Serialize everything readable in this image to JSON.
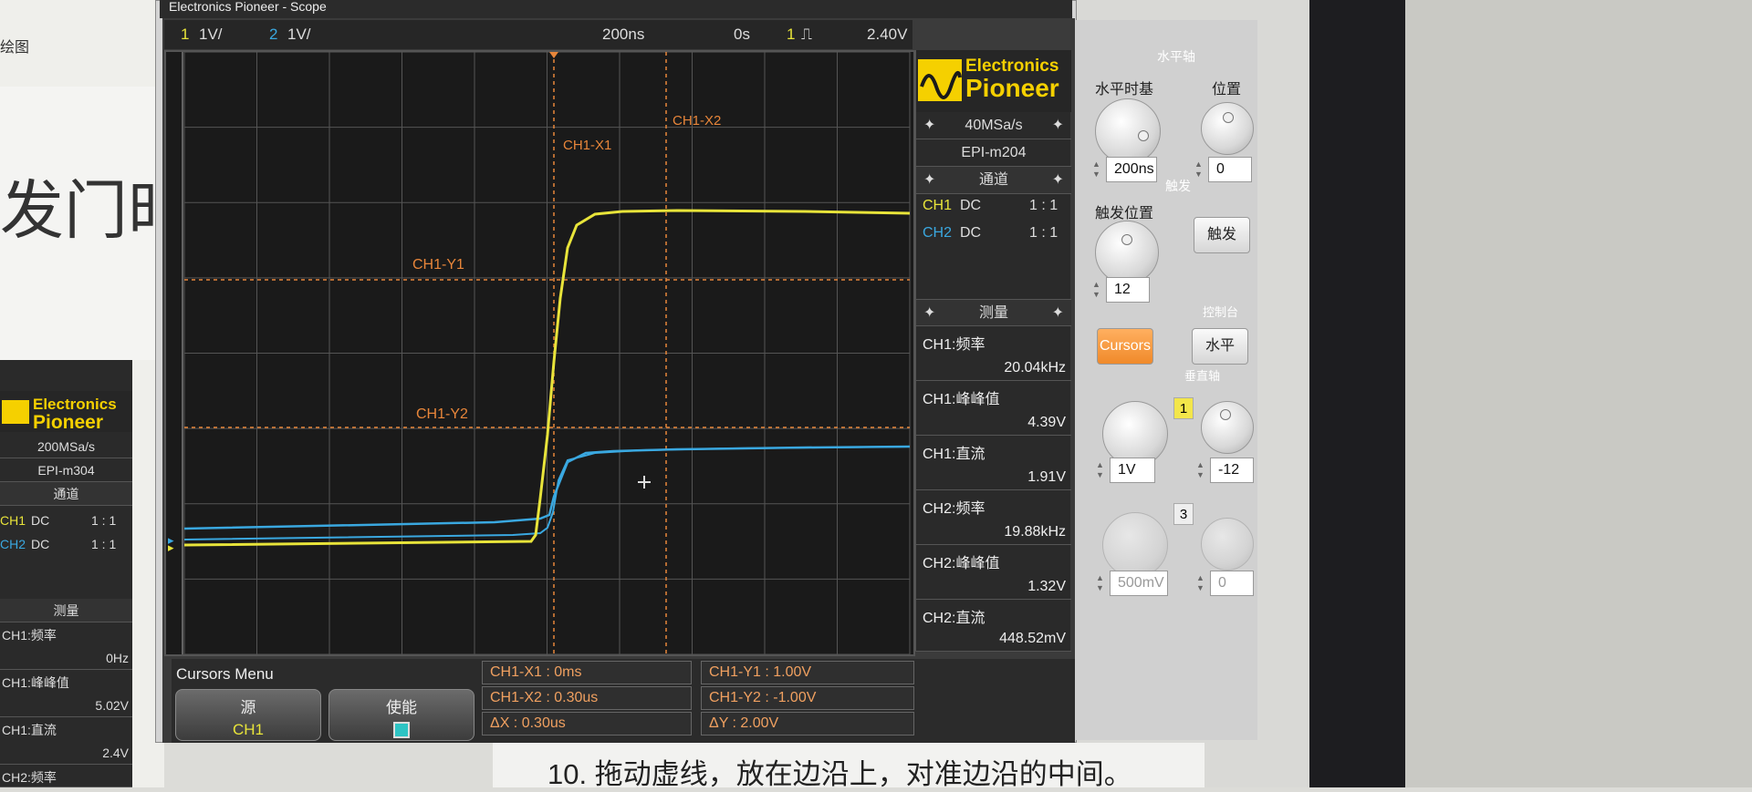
{
  "window": {
    "title": "Electronics Pioneer - Scope"
  },
  "left_app": {
    "menu_label": "绘图",
    "big_text": "发门时刻",
    "instruction": "10. 拖动虚线，放在边沿上，对准边沿的中间。"
  },
  "topbar": {
    "ch1_num": "1",
    "ch1_scale": "1V/",
    "ch2_num": "2",
    "ch2_scale": "1V/",
    "timebase": "200ns",
    "offset": "0s",
    "trig_ch": "1",
    "trig_level": "2.40V"
  },
  "screen": {
    "cursor_labels": {
      "x1": "CH1-X1",
      "x2": "CH1-X2",
      "y1": "CH1-Y1",
      "y2": "CH1-Y2"
    },
    "colors": {
      "ch1": "#e8e43a",
      "ch2": "#3aa8e0",
      "cursor": "#e8863a",
      "grid": "#555555"
    }
  },
  "panel": {
    "logo_top": "Electronics",
    "logo_bottom": "Pioneer",
    "sample_rate": "40MSa/s",
    "model": "EPI-m204",
    "channels_header": "通道",
    "channels": [
      {
        "name": "CH1",
        "coupling": "DC",
        "ratio": "1 : 1"
      },
      {
        "name": "CH2",
        "coupling": "DC",
        "ratio": "1 : 1"
      }
    ],
    "measure_header": "测量",
    "measurements": [
      {
        "label": "CH1:频率",
        "value": "20.04kHz"
      },
      {
        "label": "CH1:峰峰值",
        "value": "4.39V"
      },
      {
        "label": "CH1:直流",
        "value": "1.91V"
      },
      {
        "label": "CH2:频率",
        "value": "19.88kHz"
      },
      {
        "label": "CH2:峰峰值",
        "value": "1.32V"
      },
      {
        "label": "CH2:直流",
        "value": "448.52mV"
      }
    ]
  },
  "cursors_menu": {
    "title": "Cursors Menu",
    "source_label": "源",
    "source_value": "CH1",
    "enable_label": "使能",
    "x1": "CH1-X1 : 0ms",
    "x2": "CH1-X2 : 0.30us",
    "dx": "ΔX : 0.30us",
    "y1": "CH1-Y1 :   1.00V",
    "y2": "CH1-Y2 :   -1.00V",
    "dy": "ΔY : 2.00V"
  },
  "controls": {
    "horizontal_header": "水平轴",
    "timebase_label": "水平时基",
    "position_label": "位置",
    "timebase_value": "200ns",
    "position_value": "0",
    "trigger_header": "触发",
    "trig_pos_label": "触发位置",
    "trig_pos_value": "12",
    "trigger_button": "触发",
    "control_header": "控制台",
    "cursors_button": "Cursors",
    "horizontal_button": "水平",
    "vertical_header": "垂直轴",
    "ch1_badge": "1",
    "ch1_volts": "1V",
    "ch1_offset": "-12",
    "ch3_badge": "3",
    "ch3_volts": "500mV",
    "ch3_offset": "0"
  },
  "left_scope": {
    "logo_top": "Electronics",
    "logo_bottom": "Pioneer",
    "sample_rate": "200MSa/s",
    "model": "EPI-m304",
    "channels_header": "通道",
    "channels": [
      {
        "name": "CH1",
        "coupling": "DC",
        "ratio": "1 : 1"
      },
      {
        "name": "CH2",
        "coupling": "DC",
        "ratio": "1 : 1"
      }
    ],
    "measure_header": "测量",
    "measurements": [
      {
        "label": "CH1:频率",
        "value": "0Hz"
      },
      {
        "label": "CH1:峰峰值",
        "value": "5.02V"
      },
      {
        "label": "CH1:直流",
        "value": "2.4V"
      },
      {
        "label": "CH2:频率",
        "value": ""
      }
    ]
  }
}
